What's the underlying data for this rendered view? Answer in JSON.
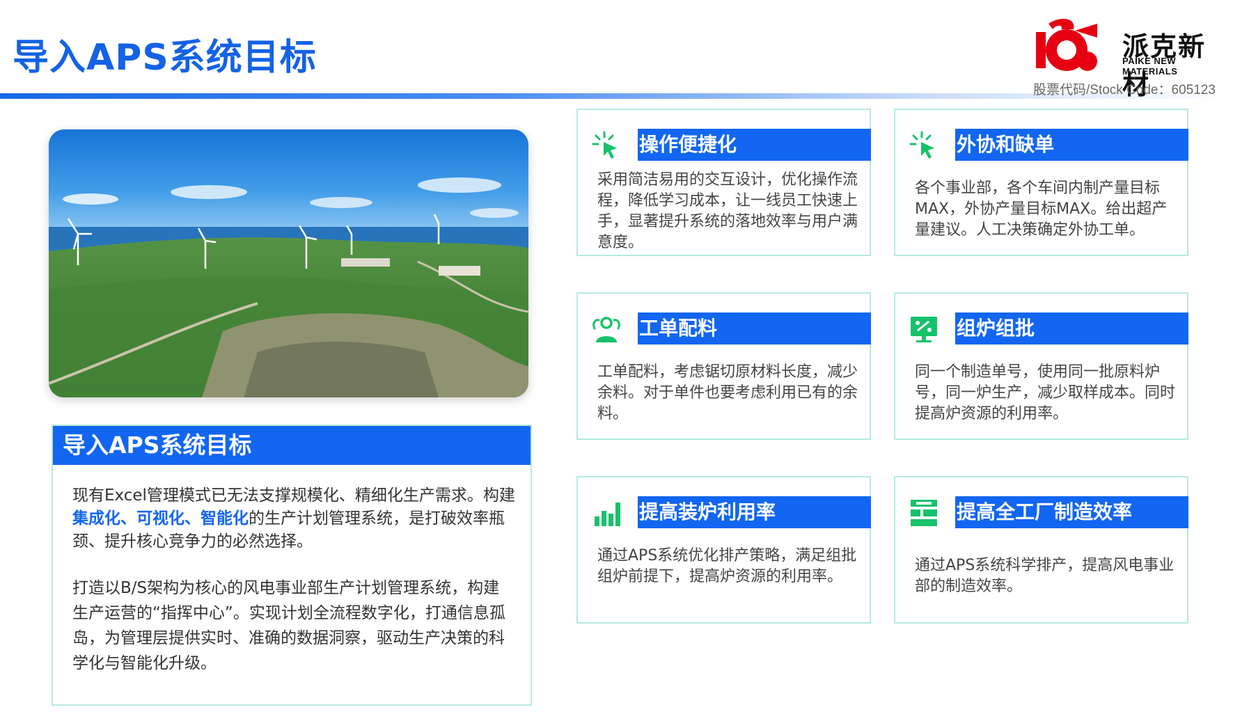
{
  "header": {
    "title": "导入APS系统目标",
    "logo_cn": "派克新材",
    "logo_en": "PAIKE NEW MATERIALS",
    "stock_code": "股票代码/Stock Code：605123"
  },
  "colors": {
    "accent": "#1266f1",
    "card_border": "#b5ecd6",
    "icon_green": "#17c26b",
    "logo_red": "#e60012"
  },
  "goal": {
    "heading": "导入APS系统目标",
    "para1_before": "现有Excel管理模式已无法支撑规模化、精细化生产需求。构建",
    "para1_highlight": "集成化、可视化、智能化",
    "para1_after": "的生产计划管理系统，是打破效率瓶颈、提升核心竞争力的必然选择。",
    "para2": "打造以B/S架构为核心的风电事业部生产计划管理系统，构建生产运营的“指挥中心”。实现计划全流程数字化，打通信息孤岛，为管理层提供实时、准确的数据洞察，驱动生产决策的科学化与智能化升级。"
  },
  "cards": [
    {
      "title": "操作便捷化",
      "icon": "cursor-click-icon",
      "desc": "采用简洁易用的交互设计，优化操作流程，降低学习成本，让一线员工快速上手，显著提升系统的落地效率与用户满意度。"
    },
    {
      "title": "外协和缺单",
      "icon": "cursor-click-icon",
      "desc": "各个事业部，各个车间内制产量目标MAX，外协产量目标MAX。给出超产量建议。人工决策确定外协工单。"
    },
    {
      "title": "工单配料",
      "icon": "team-users-icon",
      "desc": "工单配料，考虑锯切原材料长度，减少余料。对于单件也要考虑利用已有的余料。"
    },
    {
      "title": "组炉组批",
      "icon": "presentation-board-icon",
      "desc": "同一个制造单号，使用同一批原料炉号，同一炉生产，减少取样成本。同时提高炉资源的利用率。"
    },
    {
      "title": "提高装炉利用率",
      "icon": "bar-chart-icon",
      "desc": "通过APS系统优化排产策略，满足组批组炉前提下，提高炉资源的利用率。"
    },
    {
      "title": "提高全工厂制造效率",
      "icon": "process-flow-icon",
      "desc": "通过APS系统科学排产，提高风电事业部的制造效率。"
    }
  ]
}
